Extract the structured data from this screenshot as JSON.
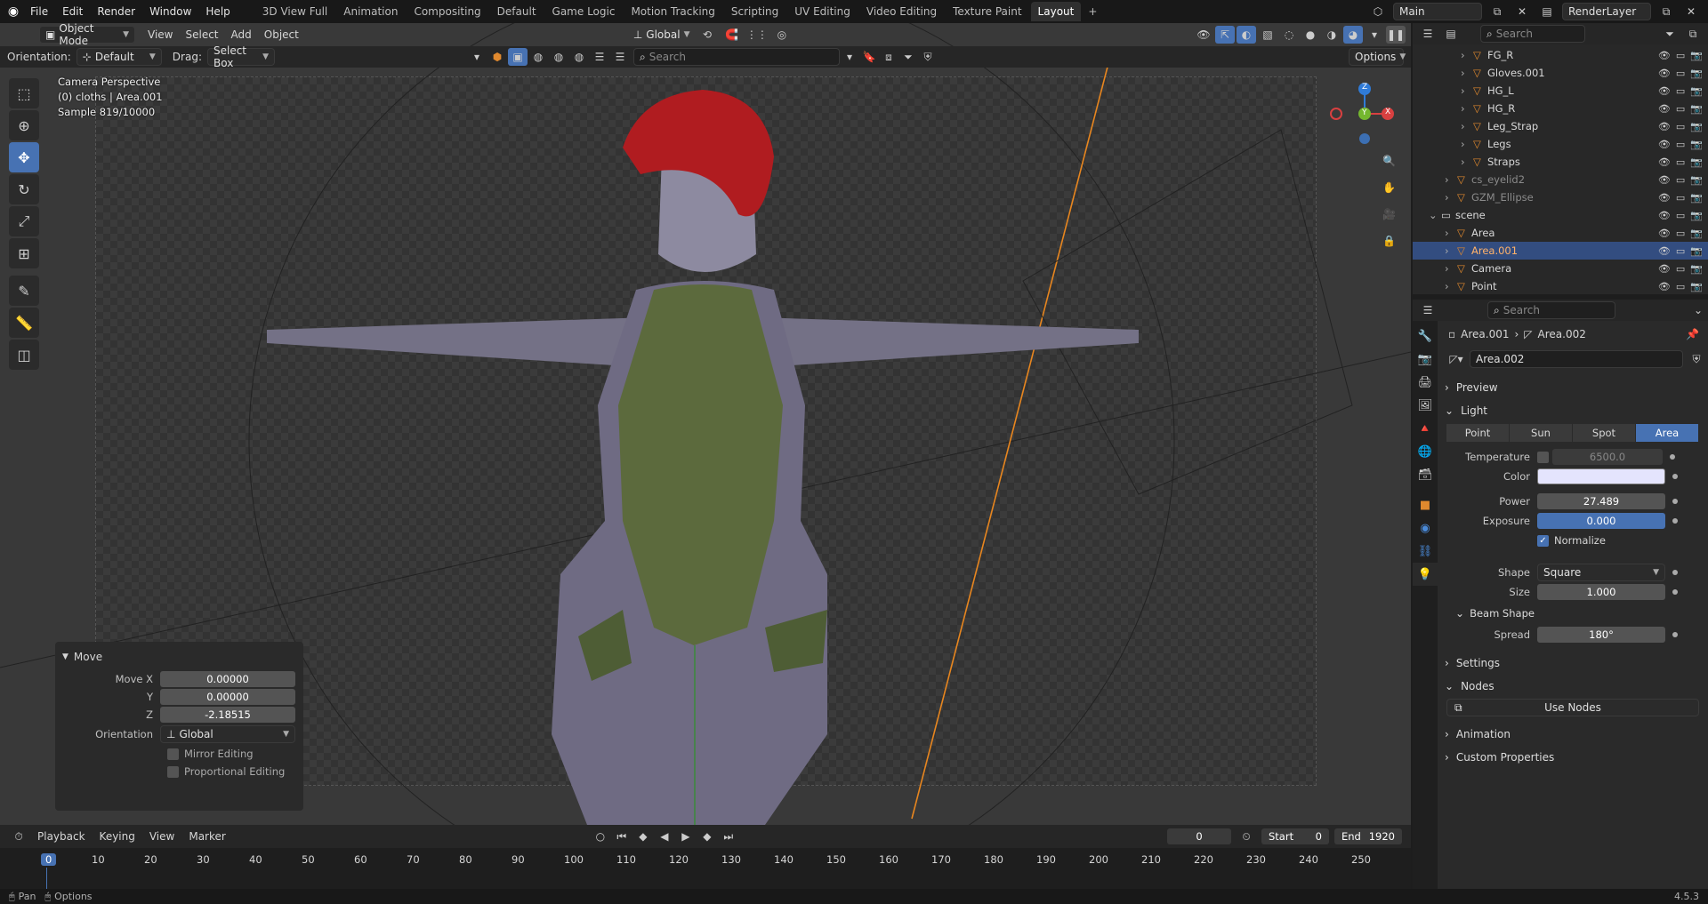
{
  "menu": {
    "items": [
      "File",
      "Edit",
      "Render",
      "Window",
      "Help"
    ],
    "workspaces": [
      "3D View Full",
      "Animation",
      "Compositing",
      "Default",
      "Game Logic",
      "Motion Tracking",
      "Scripting",
      "UV Editing",
      "Video Editing",
      "Texture Paint",
      "Layout"
    ],
    "active_workspace": "Layout",
    "add_tab": "+",
    "scene": "Main",
    "view_layer": "RenderLayer"
  },
  "viewport_header": {
    "mode": "Object Mode",
    "menus": [
      "View",
      "Select",
      "Add",
      "Object"
    ],
    "transform": "Global",
    "orientation_label": "Orientation:",
    "orientation_value": "Default",
    "drag_label": "Drag:",
    "drag_value": "Select Box",
    "search_placeholder": "Search",
    "options": "Options"
  },
  "viewport_info": {
    "line1": "Camera Perspective",
    "line2": "(0) cloths | Area.001",
    "line3": "Sample 819/10000"
  },
  "gizmo": {
    "x": "X",
    "y": "Y",
    "z": "Z"
  },
  "operator_panel": {
    "title": "Move",
    "move_x_label": "Move X",
    "move_x": "0.00000",
    "y_label": "Y",
    "y": "0.00000",
    "z_label": "Z",
    "z": "-2.18515",
    "orientation_label": "Orientation",
    "orientation": "Global",
    "mirror": "Mirror Editing",
    "proportional": "Proportional Editing"
  },
  "timeline": {
    "menus": [
      "Playback",
      "Keying",
      "View",
      "Marker"
    ],
    "current_frame": "0",
    "start_label": "Start",
    "start": "0",
    "end_label": "End",
    "end": "1920",
    "ruler": [
      "0",
      "10",
      "20",
      "30",
      "40",
      "50",
      "60",
      "70",
      "80",
      "90",
      "100",
      "110",
      "120",
      "130",
      "140",
      "150",
      "160",
      "170",
      "180",
      "190",
      "200",
      "210",
      "220",
      "230",
      "240",
      "250"
    ]
  },
  "status": {
    "left1": "Pan",
    "left2": "Options",
    "version": "4.5.3"
  },
  "outliner": {
    "search_placeholder": "Search",
    "rows": [
      {
        "name": "FG_R",
        "indent": 3,
        "dim": false
      },
      {
        "name": "Gloves.001",
        "indent": 3,
        "dim": false
      },
      {
        "name": "HG_L",
        "indent": 3,
        "dim": false
      },
      {
        "name": "HG_R",
        "indent": 3,
        "dim": false
      },
      {
        "name": "Leg_Strap",
        "indent": 3,
        "dim": false
      },
      {
        "name": "Legs",
        "indent": 3,
        "dim": false
      },
      {
        "name": "Straps",
        "indent": 3,
        "dim": false
      },
      {
        "name": "cs_eyelid2",
        "indent": 2,
        "dim": true
      },
      {
        "name": "GZM_Ellipse",
        "indent": 2,
        "dim": true
      },
      {
        "name": "scene",
        "indent": 1,
        "dim": false
      },
      {
        "name": "Area",
        "indent": 2,
        "dim": false
      },
      {
        "name": "Area.001",
        "indent": 2,
        "dim": false,
        "selected": true
      },
      {
        "name": "Camera",
        "indent": 2,
        "dim": false
      },
      {
        "name": "Point",
        "indent": 2,
        "dim": false
      }
    ]
  },
  "properties": {
    "search_placeholder": "Search",
    "breadcrumb_object": "Area.001",
    "breadcrumb_data": "Area.002",
    "datablock": "Area.002",
    "sections": {
      "preview": "Preview",
      "light": "Light",
      "settings": "Settings",
      "nodes": "Nodes",
      "animation": "Animation",
      "custom": "Custom Properties",
      "beam": "Beam Shape"
    },
    "light_types": [
      "Point",
      "Sun",
      "Spot",
      "Area"
    ],
    "active_light_type": "Area",
    "temperature_label": "Temperature",
    "temperature": "6500.0",
    "color_label": "Color",
    "color": "#e4e4fd",
    "power_label": "Power",
    "power": "27.489",
    "exposure_label": "Exposure",
    "exposure": "0.000",
    "normalize": "Normalize",
    "shape_label": "Shape",
    "shape": "Square",
    "size_label": "Size",
    "size": "1.000",
    "spread_label": "Spread",
    "spread": "180°",
    "use_nodes": "Use Nodes"
  }
}
